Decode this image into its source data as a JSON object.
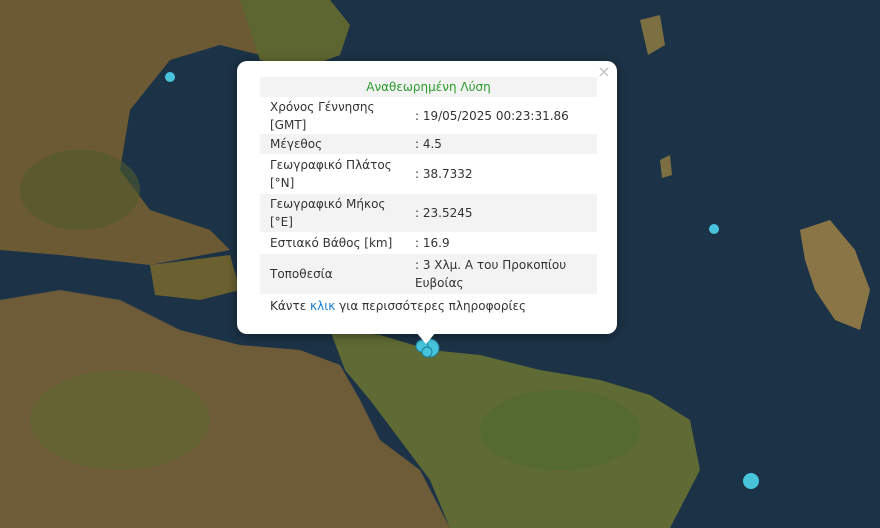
{
  "map": {
    "colors": {
      "sea": "#1c3246",
      "land": "#6b5a34",
      "quake": "#47c4dc"
    },
    "markers": [
      {
        "name": "marker-north-west",
        "size": "small"
      },
      {
        "name": "marker-east",
        "size": "small"
      },
      {
        "name": "marker-south-east",
        "size": "large"
      },
      {
        "name": "marker-main-event",
        "size": "cluster"
      }
    ]
  },
  "popup": {
    "close_icon": "×",
    "title": "Αναθεωρημένη Λύση",
    "rows": [
      {
        "label": "Χρόνος Γέννησης [GMT]",
        "value": ": 19/05/2025 00:23:31.86"
      },
      {
        "label": "Μέγεθος",
        "value": ": 4.5"
      },
      {
        "label": "Γεωγραφικό Πλάτος [°N]",
        "value": ": 38.7332"
      },
      {
        "label": "Γεωγραφικό Μήκος [°E]",
        "value": ": 23.5245"
      },
      {
        "label": "Εστιακό Βάθος [km]",
        "value": ": 16.9"
      },
      {
        "label": "Τοποθεσία",
        "value": ": 3 Χλμ. Α του Προκοπίου Ευβοίας"
      }
    ],
    "more_prefix": "Κάντε",
    "more_link": "κλικ",
    "more_suffix": "για περισσότερες πληροφορίες"
  }
}
